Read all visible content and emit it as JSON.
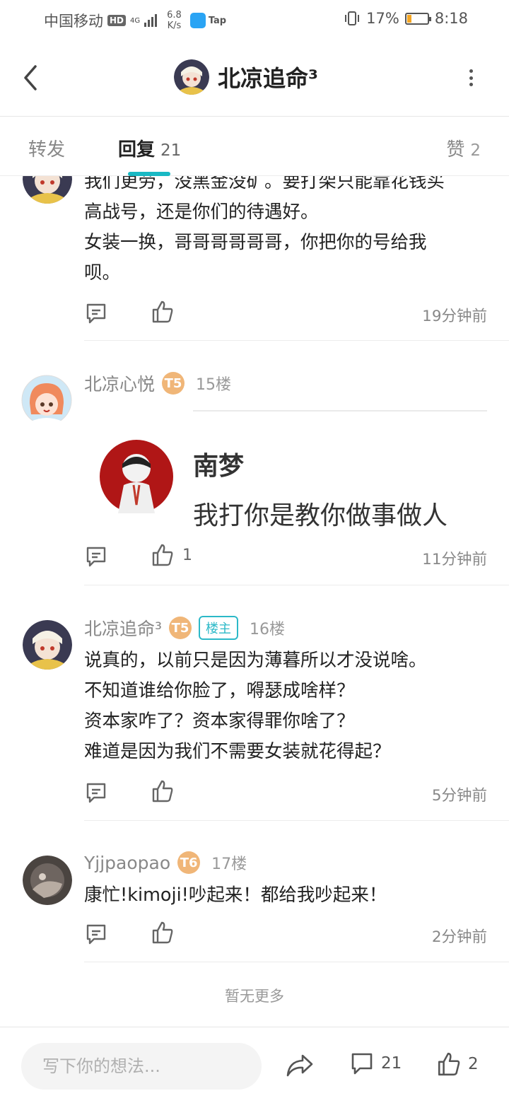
{
  "status_bar": {
    "carrier": "中国移动",
    "hd": "HD",
    "network": "4G",
    "speed_value": "6.8",
    "speed_unit": "K/s",
    "tap_label": "Tap",
    "battery": "17%",
    "time": "8:18"
  },
  "header": {
    "title": "北凉追命³",
    "back_icon": "chevron-left-icon",
    "more_icon": "more-vertical-icon"
  },
  "tabs": {
    "forward": "转发",
    "reply": "回复",
    "reply_count": "21",
    "like": "赞",
    "like_count": "2",
    "accent": "#19b9c4"
  },
  "comments": [
    {
      "lines": [
        "我们更劳，没黑金没矿。要打架只能靠花钱买",
        "高战号，还是你们的待遇好。",
        "女装一换，哥哥哥哥哥哥，你把你的号给我",
        "呗。"
      ],
      "like_count": "",
      "time": "19分钟前"
    },
    {
      "user": "北凉心悦",
      "badge": "T5",
      "floor": "15楼",
      "quote": {
        "name": "南梦",
        "text": "我打你是教你做事做人"
      },
      "like_count": "1",
      "time": "11分钟前"
    },
    {
      "user": "北凉追命³",
      "badge": "T5",
      "owner_tag": "楼主",
      "floor": "16楼",
      "lines": [
        "说真的，以前只是因为薄暮所以才没说啥。",
        "不知道谁给你脸了，嘚瑟成啥样？",
        "资本家咋了？资本家得罪你啥了？",
        "难道是因为我们不需要女装就花得起？"
      ],
      "like_count": "",
      "time": "5分钟前"
    },
    {
      "user": "Yjjpaopao",
      "badge": "T6",
      "floor": "17楼",
      "lines": [
        "康忙!kimoji!吵起来！都给我吵起来！"
      ],
      "like_count": "",
      "time": "2分钟前"
    }
  ],
  "no_more": "暂无更多",
  "bottom_bar": {
    "placeholder": "写下你的想法...",
    "comment_count": "21",
    "like_count": "2"
  }
}
